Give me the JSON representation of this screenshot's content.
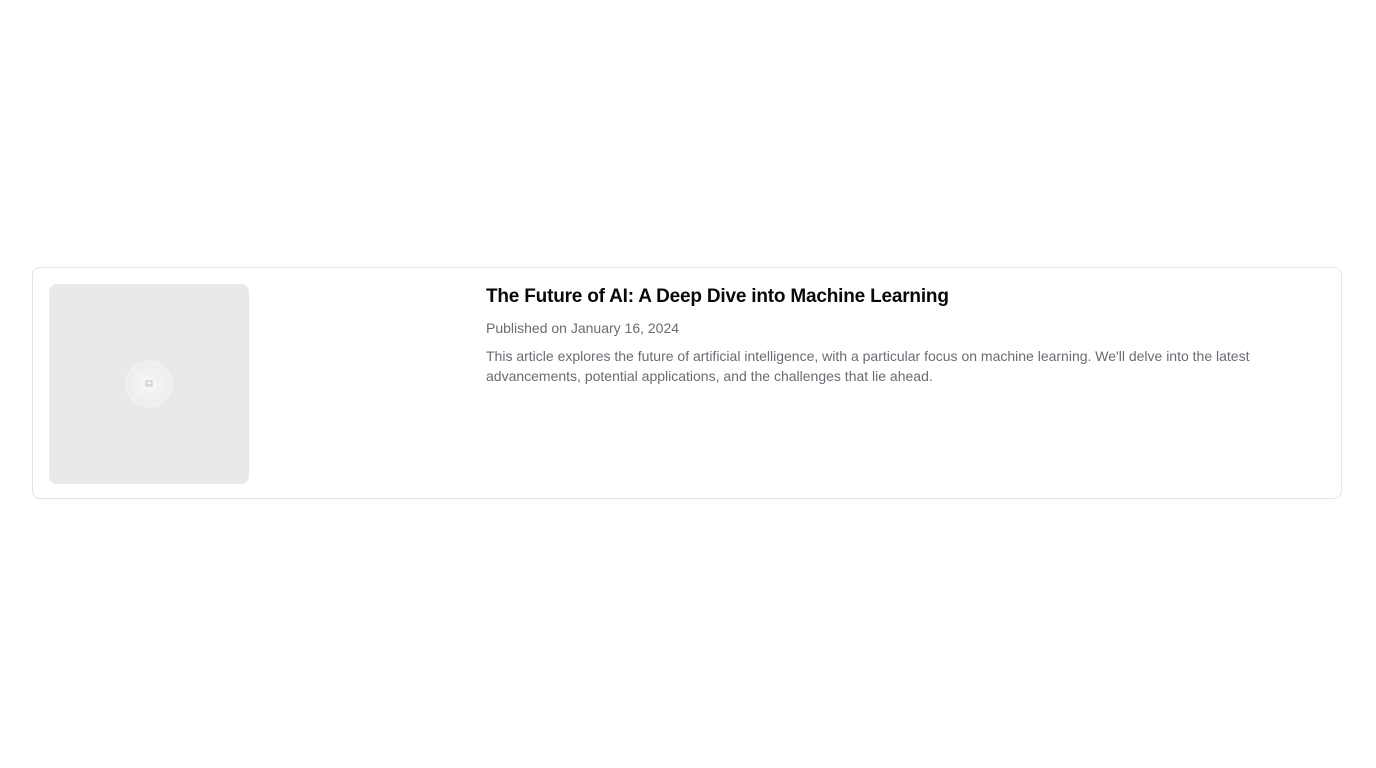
{
  "article": {
    "title": "The Future of AI: A Deep Dive into Machine Learning",
    "date": "Published on January 16, 2024",
    "summary": "This article explores the future of artificial intelligence, with a particular focus on machine learning. We'll delve into the latest advancements, potential applications, and the challenges that lie ahead.",
    "image_icon": "image-placeholder-icon"
  },
  "colors": {
    "background": "#ffffff",
    "card_border": "#e4e4e7",
    "placeholder_bg": "#e9e9e9",
    "title": "#09090b",
    "muted_text": "#6b6b73"
  }
}
